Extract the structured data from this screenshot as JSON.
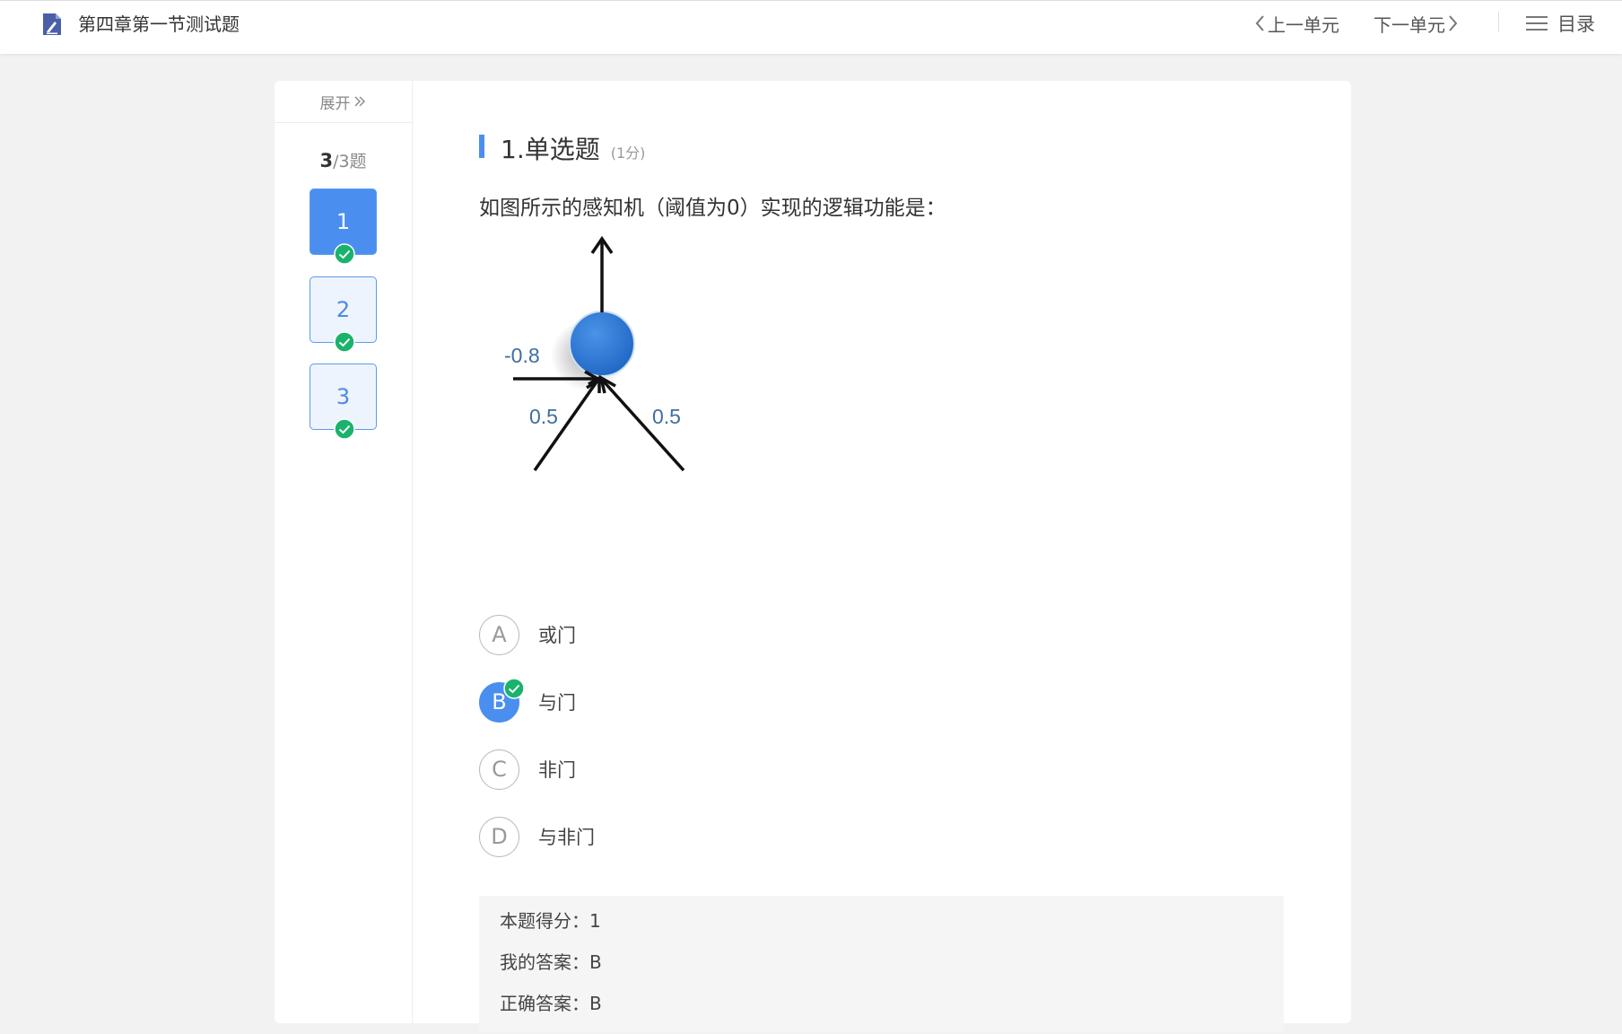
{
  "header": {
    "title": "第四章第一节测试题",
    "prev_label": "上一单元",
    "next_label": "下一单元",
    "toc_label": "目录"
  },
  "sidebar": {
    "expand_label": "展开",
    "counter_current": "3",
    "counter_rest": "/3题",
    "questions": [
      {
        "label": "1",
        "active": true,
        "answered": true
      },
      {
        "label": "2",
        "active": false,
        "answered": true
      },
      {
        "label": "3",
        "active": false,
        "answered": true
      }
    ]
  },
  "question": {
    "heading": "1.单选题",
    "score": "(1分)",
    "text": "如图所示的感知机（阈值为0）实现的逻辑功能是：",
    "diagram_labels": {
      "top_weight": "-0.8",
      "left_weight": "0.5",
      "right_weight": "0.5"
    },
    "options": [
      {
        "letter": "A",
        "label": "或门",
        "selected": false
      },
      {
        "letter": "B",
        "label": "与门",
        "selected": true
      },
      {
        "letter": "C",
        "label": "非门",
        "selected": false
      },
      {
        "letter": "D",
        "label": "与非门",
        "selected": false
      }
    ]
  },
  "result": {
    "score_label": "本题得分：1",
    "my_answer_label": "我的答案：B",
    "correct_answer_label": "正确答案：B"
  },
  "colors": {
    "accent": "#4a8ff0",
    "success": "#19b36b",
    "node": "#2e7ad6"
  }
}
